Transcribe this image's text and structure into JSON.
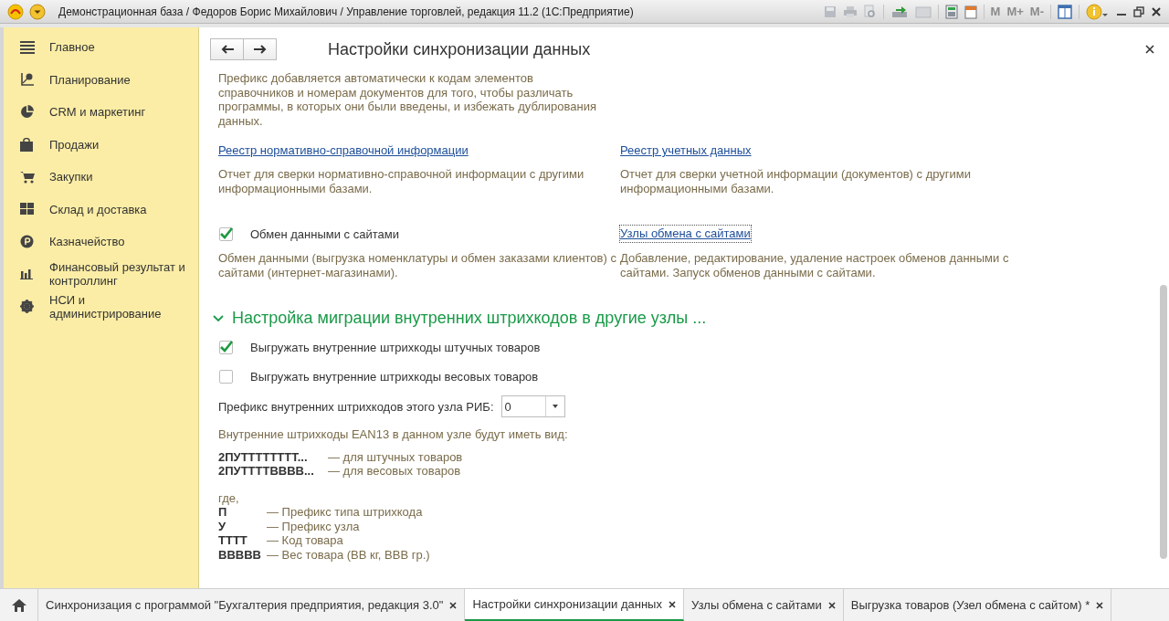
{
  "window": {
    "title": "Демонстрационная база / Федоров Борис Михайлович / Управление торговлей, редакция 11.2  (1С:Предприятие)"
  },
  "toolbar": {
    "memory_buttons": [
      "M",
      "M+",
      "M-"
    ]
  },
  "sidebar": {
    "items": [
      {
        "label": "Главное"
      },
      {
        "label": "Планирование"
      },
      {
        "label": "CRM и маркетинг"
      },
      {
        "label": "Продажи"
      },
      {
        "label": "Закупки"
      },
      {
        "label": "Склад и доставка"
      },
      {
        "label": "Казначейство"
      },
      {
        "label": "Финансовый результат и контроллинг"
      },
      {
        "label": "НСИ и администрирование"
      }
    ]
  },
  "form": {
    "title": "Настройки синхронизации данных",
    "intro": "Префикс добавляется автоматически к кодам элементов справочников и номерам документов для того, чтобы различать программы, в которых они были введены, и избежать дублирования данных.",
    "reports": [
      {
        "link": "Реестр нормативно-справочной информации",
        "description": "Отчет для сверки нормативно-справочной информации с другими информационными базами."
      },
      {
        "link": "Реестр учетных данных",
        "description": "Отчет для сверки учетной информации (документов) с другими информационными базами."
      }
    ],
    "site_exchange": {
      "label": "Обмен данными с сайтами",
      "checked": true,
      "description": "Обмен данными (выгрузка номенклатуры и обмен заказами клиентов) с сайтами (интернет-магазинами).",
      "link": "Узлы обмена с сайтами",
      "link_description": "Добавление, редактирование, удаление настроек обменов данными с сайтами. Запуск обменов данными с сайтами."
    },
    "section": {
      "title": "Настройка миграции внутренних штрихкодов в другие узлы ...",
      "expanded": true,
      "options": [
        {
          "label": "Выгружать внутренние штрихкоды штучных товаров",
          "checked": true
        },
        {
          "label": "Выгружать внутренние штрихкоды весовых товаров",
          "checked": false
        }
      ],
      "prefix": {
        "label": "Префикс внутренних штрихкодов этого узла РИБ:",
        "value": "0"
      },
      "format_intro": "Внутренние штрихкоды EAN13 в данном узле будут иметь вид:",
      "formats": [
        {
          "code": "2ПУТТТТТТТТ...",
          "note": "— для штучных товаров"
        },
        {
          "code": "2ПУТТТТВВВВ...",
          "note": "— для весовых товаров"
        }
      ],
      "legend_intro": "где,",
      "legend": [
        {
          "code": "П",
          "note": "— Префикс типа штрихкода"
        },
        {
          "code": "У",
          "note": "— Префикс узла"
        },
        {
          "code": "ТТТТ",
          "note": "— Код товара"
        },
        {
          "code": "ВВВВВ",
          "note": "— Вес товара (ВВ кг, ВВВ гр.)"
        }
      ]
    }
  },
  "tabs": [
    {
      "label": "Синхронизация с программой \"Бухгалтерия предприятия, редакция 3.0\"",
      "selected": false
    },
    {
      "label": "Настройки синхронизации данных",
      "selected": true
    },
    {
      "label": "Узлы обмена с сайтами",
      "selected": false
    },
    {
      "label": "Выгрузка товаров (Узел обмена с сайтом) *",
      "selected": false
    }
  ]
}
